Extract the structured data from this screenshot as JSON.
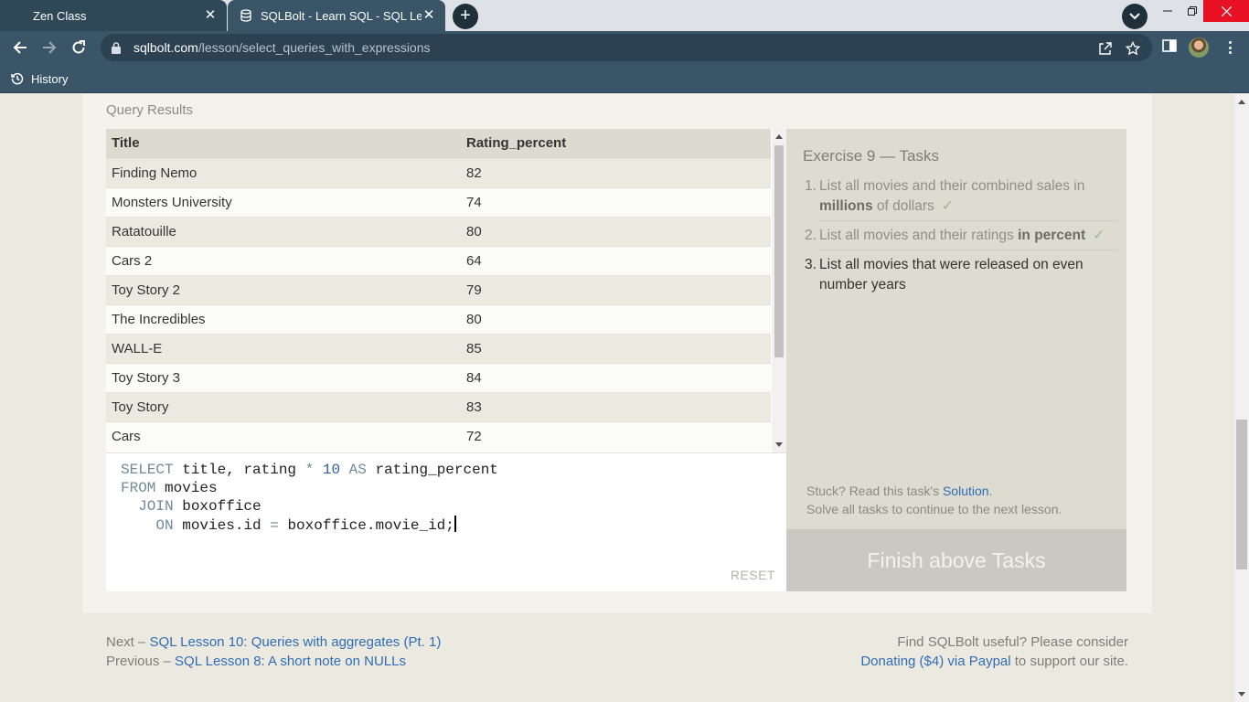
{
  "browser": {
    "tabs": [
      {
        "title": "Zen Class",
        "active": false
      },
      {
        "title": "SQLBolt - Learn SQL - SQL Lesson",
        "active": true
      }
    ],
    "url_host": "sqlbolt.com",
    "url_path": "/lesson/select_queries_with_expressions",
    "bookmark_history": "History",
    "colors": {
      "chrome": "#3a5568",
      "close_hover": "#e81123"
    }
  },
  "page": {
    "query_results_label": "Query Results",
    "table": {
      "headers": [
        "Title",
        "Rating_percent"
      ],
      "rows": [
        [
          "Finding Nemo",
          "82"
        ],
        [
          "Monsters University",
          "74"
        ],
        [
          "Ratatouille",
          "80"
        ],
        [
          "Cars 2",
          "64"
        ],
        [
          "Toy Story 2",
          "79"
        ],
        [
          "The Incredibles",
          "80"
        ],
        [
          "WALL-E",
          "85"
        ],
        [
          "Toy Story 3",
          "84"
        ],
        [
          "Toy Story",
          "83"
        ],
        [
          "Cars",
          "72"
        ]
      ]
    },
    "editor": {
      "lines": [
        [
          {
            "t": "SELECT",
            "k": "kw"
          },
          {
            "t": " title, rating "
          },
          {
            "t": "*",
            "k": "kw"
          },
          {
            "t": " "
          },
          {
            "t": "10",
            "k": "num"
          },
          {
            "t": " "
          },
          {
            "t": "AS",
            "k": "kw"
          },
          {
            "t": " rating_percent"
          }
        ],
        [
          {
            "t": "FROM",
            "k": "kw"
          },
          {
            "t": " movies"
          }
        ],
        [
          {
            "t": "  "
          },
          {
            "t": "JOIN",
            "k": "kw"
          },
          {
            "t": " boxoffice"
          }
        ],
        [
          {
            "t": "    "
          },
          {
            "t": "ON",
            "k": "kw"
          },
          {
            "t": " movies.id "
          },
          {
            "t": "=",
            "k": "kw"
          },
          {
            "t": " boxoffice.movie_id;"
          }
        ]
      ],
      "reset_label": "RESET"
    },
    "tasks": {
      "title": "Exercise 9 — Tasks",
      "items": [
        {
          "num": "1.",
          "pre": "List all movies and their combined sales in ",
          "bold": "millions",
          "post": " of dollars",
          "done": true
        },
        {
          "num": "2.",
          "pre": "List all movies and their ratings ",
          "bold": "in percent",
          "post": "",
          "done": true
        },
        {
          "num": "3.",
          "pre": "List all movies that were released on even number years",
          "bold": "",
          "post": "",
          "done": false
        }
      ],
      "check_mark": "✓",
      "stuck_text": "Stuck? Read this task's ",
      "solution_link": "Solution",
      "stuck_period": ".",
      "continue_text": "Solve all tasks to continue to the next lesson."
    },
    "finish_button": "Finish above Tasks",
    "footer": {
      "next_prefix": "Next – ",
      "next_link": "SQL Lesson 10: Queries with aggregates (Pt. 1)",
      "prev_prefix": "Previous – ",
      "prev_link": "SQL Lesson 8: A short note on NULLs",
      "useful_text": "Find SQLBolt useful? Please consider",
      "donate_link": "Donating ($4) via Paypal",
      "donate_suffix": " to support our site."
    }
  }
}
